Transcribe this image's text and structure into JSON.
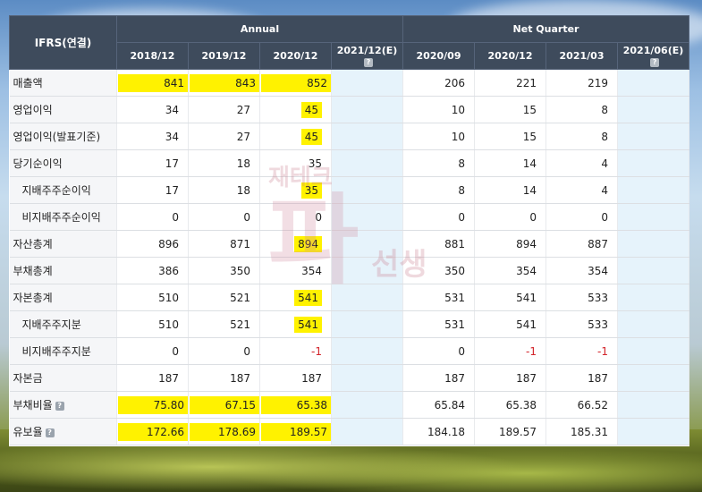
{
  "table": {
    "corner_label": "IFRS(연결)",
    "group_annual": "Annual",
    "group_quarter": "Net Quarter",
    "columns": [
      "2018/12",
      "2019/12",
      "2020/12",
      "2021/12(E)",
      "2020/09",
      "2020/12",
      "2021/03",
      "2021/06(E)"
    ],
    "rows": [
      {
        "label": "매출액",
        "sub": false,
        "values": [
          "841",
          "843",
          "852",
          "",
          "206",
          "221",
          "219",
          ""
        ],
        "hl": [
          0,
          1,
          2
        ]
      },
      {
        "label": "영업이익",
        "sub": false,
        "values": [
          "34",
          "27",
          "45",
          "",
          "10",
          "15",
          "8",
          ""
        ],
        "hl": [
          2
        ]
      },
      {
        "label": "영업이익(발표기준)",
        "sub": false,
        "values": [
          "34",
          "27",
          "45",
          "",
          "10",
          "15",
          "8",
          ""
        ],
        "hl": [
          2
        ]
      },
      {
        "label": "당기순이익",
        "sub": false,
        "values": [
          "17",
          "18",
          "35",
          "",
          "8",
          "14",
          "4",
          ""
        ],
        "hl": []
      },
      {
        "label": "지배주주순이익",
        "sub": true,
        "values": [
          "17",
          "18",
          "35",
          "",
          "8",
          "14",
          "4",
          ""
        ],
        "hl": [
          2
        ]
      },
      {
        "label": "비지배주주순이익",
        "sub": true,
        "values": [
          "0",
          "0",
          "0",
          "",
          "0",
          "0",
          "0",
          ""
        ],
        "hl": []
      },
      {
        "label": "자산총계",
        "sub": false,
        "values": [
          "896",
          "871",
          "894",
          "",
          "881",
          "894",
          "887",
          ""
        ],
        "hl": [
          2
        ]
      },
      {
        "label": "부채총계",
        "sub": false,
        "values": [
          "386",
          "350",
          "354",
          "",
          "350",
          "354",
          "354",
          ""
        ],
        "hl": []
      },
      {
        "label": "자본총계",
        "sub": false,
        "values": [
          "510",
          "521",
          "541",
          "",
          "531",
          "541",
          "533",
          ""
        ],
        "hl": [
          2
        ]
      },
      {
        "label": "지배주주지분",
        "sub": true,
        "values": [
          "510",
          "521",
          "541",
          "",
          "531",
          "541",
          "533",
          ""
        ],
        "hl": [
          2
        ]
      },
      {
        "label": "비지배주주지분",
        "sub": true,
        "values": [
          "0",
          "0",
          "-1",
          "",
          "0",
          "-1",
          "-1",
          ""
        ],
        "hl": []
      },
      {
        "label": "자본금",
        "sub": false,
        "values": [
          "187",
          "187",
          "187",
          "",
          "187",
          "187",
          "187",
          ""
        ],
        "hl": []
      },
      {
        "label": "부채비율",
        "sub": false,
        "help": true,
        "values": [
          "75.80",
          "67.15",
          "65.38",
          "",
          "65.84",
          "65.38",
          "66.52",
          ""
        ],
        "hl": [
          0,
          1,
          2
        ]
      },
      {
        "label": "유보율",
        "sub": false,
        "help": true,
        "values": [
          "172.66",
          "178.69",
          "189.57",
          "",
          "184.18",
          "189.57",
          "185.31",
          ""
        ],
        "hl": [
          0,
          1,
          2
        ]
      }
    ]
  },
  "watermark_text": [
    "재테크",
    "파",
    "선생"
  ],
  "colors": {
    "header": "#3e4b5c",
    "highlight": "#fff200",
    "negative": "#d3242b",
    "estimate_bg": "#e6f3fb"
  }
}
